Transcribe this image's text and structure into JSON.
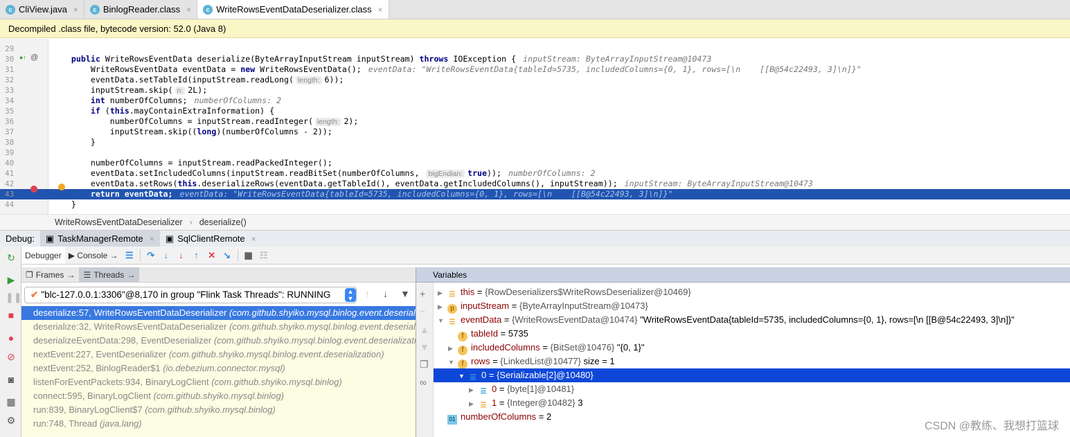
{
  "tabs": [
    {
      "label": "CliView.java",
      "active": false
    },
    {
      "label": "BinlogReader.class",
      "active": false
    },
    {
      "label": "WriteRowsEventDataDeserializer.class",
      "active": true
    }
  ],
  "banner": "Decompiled .class file, bytecode version: 52.0 (Java 8)",
  "code": [
    {
      "n": "29",
      "s": []
    },
    {
      "n": "30",
      "s": [
        {
          "k": "plain",
          "t": "    "
        },
        {
          "k": "kw",
          "t": "public"
        },
        {
          "k": "plain",
          "t": " WriteRowsEventData deserialize(ByteArrayInputStream inputStream) "
        },
        {
          "k": "kw",
          "t": "throws"
        },
        {
          "k": "plain",
          "t": " IOException {"
        },
        {
          "k": "hint",
          "t": "inputStream: ByteArrayInputStream@10473"
        }
      ]
    },
    {
      "n": "31",
      "s": [
        {
          "k": "plain",
          "t": "        WriteRowsEventData eventData = "
        },
        {
          "k": "kw",
          "t": "new"
        },
        {
          "k": "plain",
          "t": " WriteRowsEventData();"
        },
        {
          "k": "hint",
          "t": "eventData: \"WriteRowsEventData{tableId=5735, includedColumns={0, 1}, rows=[\\n    [[B@54c22493, 3]\\n]}\""
        }
      ]
    },
    {
      "n": "32",
      "s": [
        {
          "k": "plain",
          "t": "        eventData.setTableId(inputStream.readLong("
        },
        {
          "k": "inlay",
          "t": "length:"
        },
        {
          "k": "plain",
          "t": "6));"
        }
      ]
    },
    {
      "n": "33",
      "s": [
        {
          "k": "plain",
          "t": "        inputStream.skip("
        },
        {
          "k": "inlay",
          "t": "n:"
        },
        {
          "k": "plain",
          "t": "2L);"
        }
      ]
    },
    {
      "n": "34",
      "s": [
        {
          "k": "plain",
          "t": "        "
        },
        {
          "k": "kw",
          "t": "int"
        },
        {
          "k": "plain",
          "t": " numberOfColumns;"
        },
        {
          "k": "hint",
          "t": "numberOfColumns: 2"
        }
      ]
    },
    {
      "n": "35",
      "s": [
        {
          "k": "plain",
          "t": "        "
        },
        {
          "k": "kw",
          "t": "if"
        },
        {
          "k": "plain",
          "t": " ("
        },
        {
          "k": "kw",
          "t": "this"
        },
        {
          "k": "plain",
          "t": ".mayContainExtraInformation) {"
        }
      ]
    },
    {
      "n": "36",
      "s": [
        {
          "k": "plain",
          "t": "            numberOfColumns = inputStream.readInteger("
        },
        {
          "k": "inlay",
          "t": "length:"
        },
        {
          "k": "plain",
          "t": "2);"
        }
      ]
    },
    {
      "n": "37",
      "s": [
        {
          "k": "plain",
          "t": "            inputStream.skip(("
        },
        {
          "k": "kw",
          "t": "long"
        },
        {
          "k": "plain",
          "t": ")(numberOfColumns - 2));"
        }
      ]
    },
    {
      "n": "38",
      "s": [
        {
          "k": "plain",
          "t": "        }"
        }
      ]
    },
    {
      "n": "39",
      "s": []
    },
    {
      "n": "40",
      "s": [
        {
          "k": "plain",
          "t": "        numberOfColumns = inputStream.readPackedInteger();"
        }
      ]
    },
    {
      "n": "41",
      "s": [
        {
          "k": "plain",
          "t": "        eventData.setIncludedColumns(inputStream.readBitSet(numberOfColumns, "
        },
        {
          "k": "inlay",
          "t": "bigEndian:"
        },
        {
          "k": "kw",
          "t": "true"
        },
        {
          "k": "plain",
          "t": "));"
        },
        {
          "k": "hint",
          "t": "numberOfColumns: 2"
        }
      ]
    },
    {
      "n": "42",
      "s": [
        {
          "k": "plain",
          "t": "        eventData.setRows("
        },
        {
          "k": "kw",
          "t": "this"
        },
        {
          "k": "plain",
          "t": ".deserializeRows(eventData.getTableId(), eventData.getIncludedColumns(), inputStream));"
        },
        {
          "k": "hint",
          "t": "inputStream: ByteArrayInputStream@10473"
        }
      ]
    },
    {
      "n": "43",
      "current": true,
      "s": [
        {
          "k": "kw",
          "t": "        return"
        },
        {
          "k": "kw",
          "t": " eventData;"
        },
        {
          "k": "hint",
          "t": "eventData: \"WriteRowsEventData{tableId=5735, includedColumns={0, 1}, rows=[\\n    [[B@54c22493, 3]\\n]}\""
        }
      ]
    },
    {
      "n": "44",
      "s": [
        {
          "k": "plain",
          "t": "    }"
        }
      ]
    }
  ],
  "breadcrumb": [
    "WriteRowsEventDataDeserializer",
    "deserialize()"
  ],
  "debug": {
    "label": "Debug:",
    "sessions": [
      {
        "label": "TaskManagerRemote",
        "active": true
      },
      {
        "label": "SqlClientRemote",
        "active": false
      }
    ],
    "toolbar_tabs": [
      {
        "label": "Debugger",
        "active": true
      },
      {
        "label": "Console",
        "active": false
      }
    ],
    "frames_tabs": [
      {
        "label": "Frames",
        "active": false
      },
      {
        "label": "Threads",
        "active": true
      }
    ],
    "thread": "\"blc-127.0.0.1:3306\"@8,170 in group \"Flink Task Threads\": RUNNING",
    "frames": [
      {
        "m": "deserialize:57, WriteRowsEventDataDeserializer",
        "p": "(com.github.shyiko.mysql.binlog.event.deserialization)",
        "selected": true
      },
      {
        "m": "deserialize:32, WriteRowsEventDataDeserializer",
        "p": "(com.github.shyiko.mysql.binlog.event.deserialization)"
      },
      {
        "m": "deserializeEventData:298, EventDeserializer",
        "p": "(com.github.shyiko.mysql.binlog.event.deserialization)"
      },
      {
        "m": "nextEvent:227, EventDeserializer",
        "p": "(com.github.shyiko.mysql.binlog.event.deserialization)"
      },
      {
        "m": "nextEvent:252, BinlogReader$1",
        "p": "(io.debezium.connector.mysql)"
      },
      {
        "m": "listenForEventPackets:934, BinaryLogClient",
        "p": "(com.github.shyiko.mysql.binlog)"
      },
      {
        "m": "connect:595, BinaryLogClient",
        "p": "(com.github.shyiko.mysql.binlog)"
      },
      {
        "m": "run:839, BinaryLogClient$7",
        "p": "(com.github.shyiko.mysql.binlog)"
      },
      {
        "m": "run:748, Thread",
        "p": "(java.lang)"
      }
    ],
    "variables_title": "Variables",
    "variables": [
      {
        "depth": 0,
        "tri": "right",
        "icon": "bars",
        "name": "this",
        "type": "{RowDeserializers$WriteRowsDeserializer@10469}",
        "val": ""
      },
      {
        "depth": 0,
        "tri": "right",
        "icon": "p",
        "name": "inputStream",
        "type": "{ByteArrayInputStream@10473}",
        "val": ""
      },
      {
        "depth": 0,
        "tri": "down",
        "icon": "bars",
        "name": "eventData",
        "type": "{WriteRowsEventData@10474}",
        "val": "\"WriteRowsEventData{tableId=5735, includedColumns={0, 1}, rows=[\\n    [[B@54c22493, 3]\\n]}\""
      },
      {
        "depth": 1,
        "tri": "",
        "icon": "f",
        "name": "tableId",
        "type": "",
        "val": "5735"
      },
      {
        "depth": 1,
        "tri": "right",
        "icon": "f",
        "name": "includedColumns",
        "type": "{BitSet@10476}",
        "val": "\"{0, 1}\""
      },
      {
        "depth": 1,
        "tri": "down",
        "icon": "f",
        "name": "rows",
        "type": "{LinkedList@10477}",
        "val": " size = 1"
      },
      {
        "depth": 2,
        "tri": "down",
        "icon": "arr",
        "name": "0",
        "type": "{Serializable[2]@10480}",
        "val": "",
        "selected": true
      },
      {
        "depth": 3,
        "tri": "right",
        "icon": "arr",
        "name": "0",
        "type": "{byte[1]@10481}",
        "val": ""
      },
      {
        "depth": 3,
        "tri": "right",
        "icon": "bars",
        "name": "1",
        "type": "{Integer@10482}",
        "val": "3"
      },
      {
        "depth": 0,
        "tri": "",
        "icon": "num",
        "name": "numberOfColumns",
        "type": "",
        "val": "2"
      }
    ]
  },
  "watermark": "CSDN @教练、我想打篮球",
  "colors": {
    "selection": "#2154b0",
    "frame_selection": "#3878e0",
    "var_selection": "#0e47d8",
    "banner": "#fbf6c5"
  }
}
